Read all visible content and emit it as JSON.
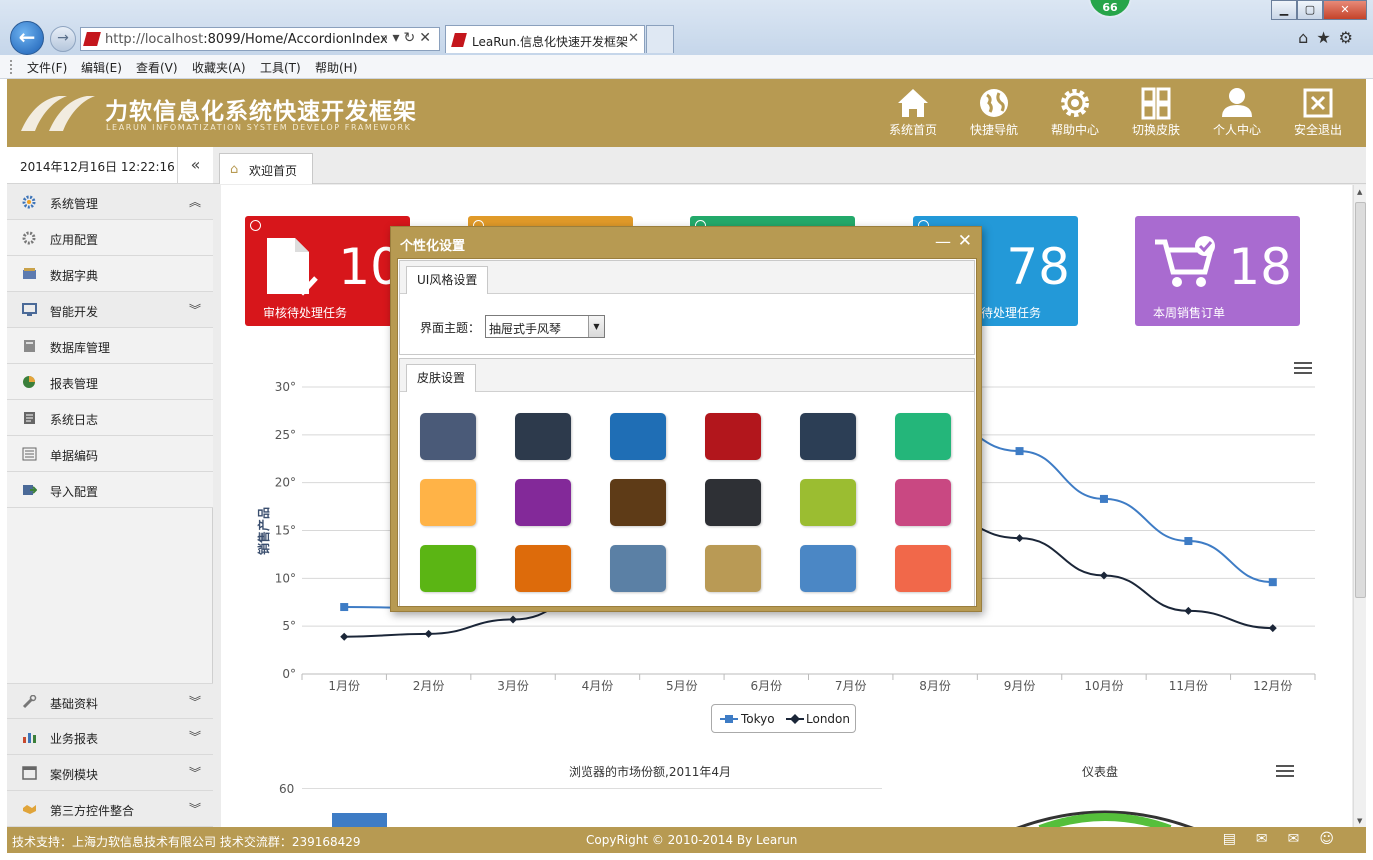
{
  "browser": {
    "url_host": "http://localhost",
    "url_path": ":8099/Home/AccordionIndex",
    "tab_title": "LeaRun.信息化快速开发框架",
    "notification_count": "66",
    "menu": [
      "文件(F)",
      "编辑(E)",
      "查看(V)",
      "收藏夹(A)",
      "工具(T)",
      "帮助(H)"
    ]
  },
  "header": {
    "title": "力软信息化系统快速开发框架",
    "subtitle": "LEARUN INFOMATIZATION SYSTEM DEVELOP FRAMEWORK",
    "nav": [
      {
        "label": "系统首页",
        "icon": "home-icon"
      },
      {
        "label": "快捷导航",
        "icon": "globe-icon"
      },
      {
        "label": "帮助中心",
        "icon": "gear-icon"
      },
      {
        "label": "切换皮肤",
        "icon": "grid-icon"
      },
      {
        "label": "个人中心",
        "icon": "user-icon"
      },
      {
        "label": "安全退出",
        "icon": "exit-icon"
      }
    ]
  },
  "sidebar": {
    "datetime": "2014年12月16日 12:22:16",
    "collapse_icon": "double-chevron-left-icon",
    "items": [
      {
        "label": "系统管理",
        "type": "group",
        "expanded": true
      },
      {
        "label": "应用配置",
        "type": "item"
      },
      {
        "label": "数据字典",
        "type": "item"
      },
      {
        "label": "智能开发",
        "type": "group",
        "expanded": false
      },
      {
        "label": "数据库管理",
        "type": "item"
      },
      {
        "label": "报表管理",
        "type": "item"
      },
      {
        "label": "系统日志",
        "type": "item"
      },
      {
        "label": "单据编码",
        "type": "item"
      },
      {
        "label": "导入配置",
        "type": "item"
      }
    ],
    "bottom_groups": [
      {
        "label": "基础资料"
      },
      {
        "label": "业务报表"
      },
      {
        "label": "案例模块"
      },
      {
        "label": "第三方控件整合"
      }
    ]
  },
  "tabs": {
    "welcome": "欢迎首页"
  },
  "stat_cards": [
    {
      "value": "10",
      "label": "审核待处理任务",
      "color": "#d7161b"
    },
    {
      "value": "",
      "label": "",
      "color": "#e09a29"
    },
    {
      "value": "",
      "label": "",
      "color": "#23a96a"
    },
    {
      "value": "78",
      "label": "待处理任务",
      "color": "#2399d8"
    },
    {
      "value": "18",
      "label": "本周销售订单",
      "color": "#a96bd0"
    }
  ],
  "chart_data": [
    {
      "type": "line",
      "ylabel": "销售产品",
      "ylim": [
        0,
        30
      ],
      "yticks": [
        "0°",
        "5°",
        "10°",
        "15°",
        "20°",
        "25°",
        "30°"
      ],
      "categories": [
        "1月份",
        "2月份",
        "3月份",
        "4月份",
        "5月份",
        "6月份",
        "7月份",
        "8月份",
        "9月份",
        "10月份",
        "11月份",
        "12月份"
      ],
      "series": [
        {
          "name": "Tokyo",
          "color": "#3e7cc5",
          "values": [
            7.0,
            6.9,
            9.5,
            14.5,
            18.2,
            21.5,
            25.2,
            26.5,
            23.3,
            18.3,
            13.9,
            9.6
          ]
        },
        {
          "name": "London",
          "color": "#1b2638",
          "values": [
            3.9,
            4.2,
            5.7,
            8.5,
            11.9,
            15.2,
            17.0,
            16.6,
            14.2,
            10.3,
            6.6,
            4.8
          ]
        }
      ],
      "legend": "bottom-center"
    },
    {
      "type": "bar",
      "title": "浏览器的市场份额,2011年4月",
      "yticks": [
        "60"
      ]
    },
    {
      "type": "gauge",
      "title": "仪表盘"
    }
  ],
  "modal": {
    "title": "个性化设置",
    "ui_tab": "UI风格设置",
    "theme_label": "界面主题：",
    "theme_value": "抽屉式手风琴",
    "skin_tab": "皮肤设置",
    "skins": [
      "#4a5a78",
      "#2d3a4c",
      "#1f6eb5",
      "#b2161c",
      "#2c3e55",
      "#24b67a",
      "#ffb347",
      "#832999",
      "#5e3b17",
      "#2e3035",
      "#9bbd31",
      "#c94882",
      "#5bb514",
      "#dd6b0b",
      "#5b80a5",
      "#b99a55",
      "#4b87c5",
      "#f1684a"
    ]
  },
  "footer": {
    "support": "技术支持：上海力软信息技术有限公司   技术交流群：239168429",
    "copyright": "CopyRight © 2010-2014 By Learun"
  }
}
